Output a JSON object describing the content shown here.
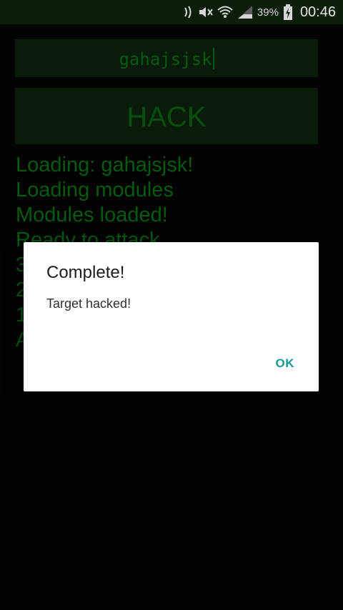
{
  "status_bar": {
    "battery_percent": "39%",
    "time": "00:46",
    "icons": [
      "nfc-icon",
      "mute-icon",
      "wifi-icon",
      "signal-icon",
      "battery-charging-icon"
    ]
  },
  "input": {
    "value": "gahajsjsk"
  },
  "hack_button": {
    "label": "HACK"
  },
  "log": {
    "lines": [
      "Loading: gahajsjsk!",
      "Loading modules",
      "Modules loaded!",
      "Ready to attack",
      "3",
      "2",
      "1",
      "A"
    ]
  },
  "dialog": {
    "title": "Complete!",
    "message": "Target hacked!",
    "ok_label": "OK"
  },
  "colors": {
    "terminal_green": "#0a8a1a",
    "panel_green": "#0e2a0e",
    "dialog_accent": "#139a8f"
  }
}
